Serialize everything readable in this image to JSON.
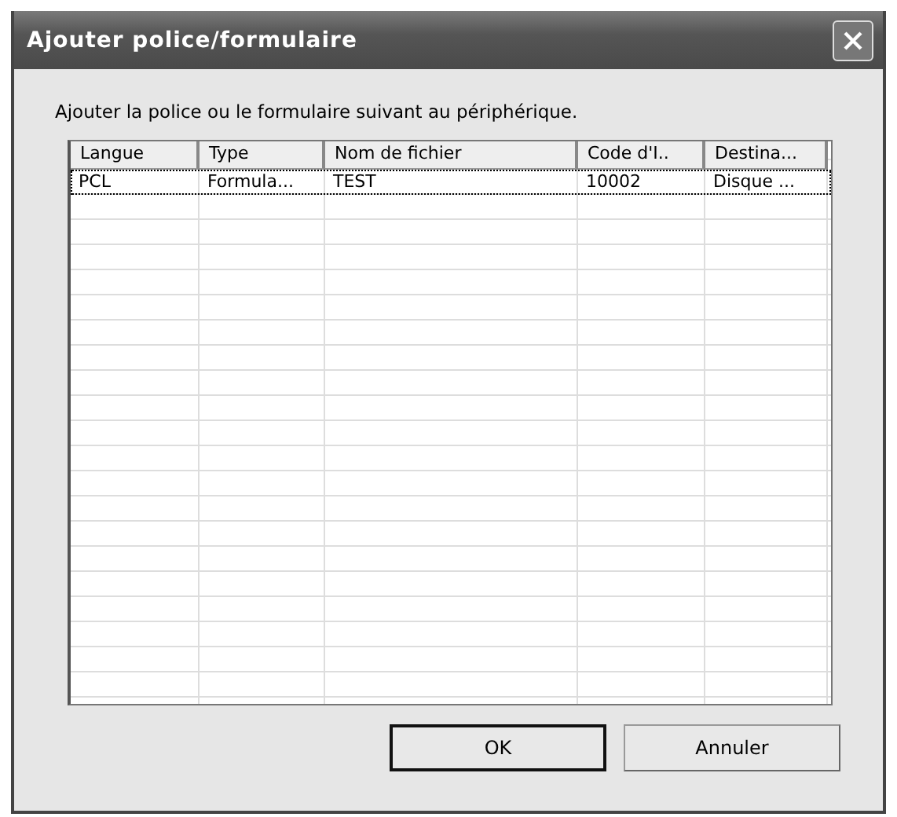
{
  "window": {
    "title": "Ajouter police/formulaire"
  },
  "message": "Ajouter la police ou le formulaire suivant au périphérique.",
  "table": {
    "columns": [
      "Langue",
      "Type",
      "Nom de fichier",
      "Code d'I..",
      "Destina..."
    ],
    "rows": [
      {
        "cells": [
          "PCL",
          "Formula...",
          "TEST",
          "10002",
          "Disque ..."
        ],
        "focused": true
      }
    ]
  },
  "buttons": [
    {
      "label": "OK",
      "default": true
    },
    {
      "label": "Annuler",
      "default": false
    }
  ]
}
